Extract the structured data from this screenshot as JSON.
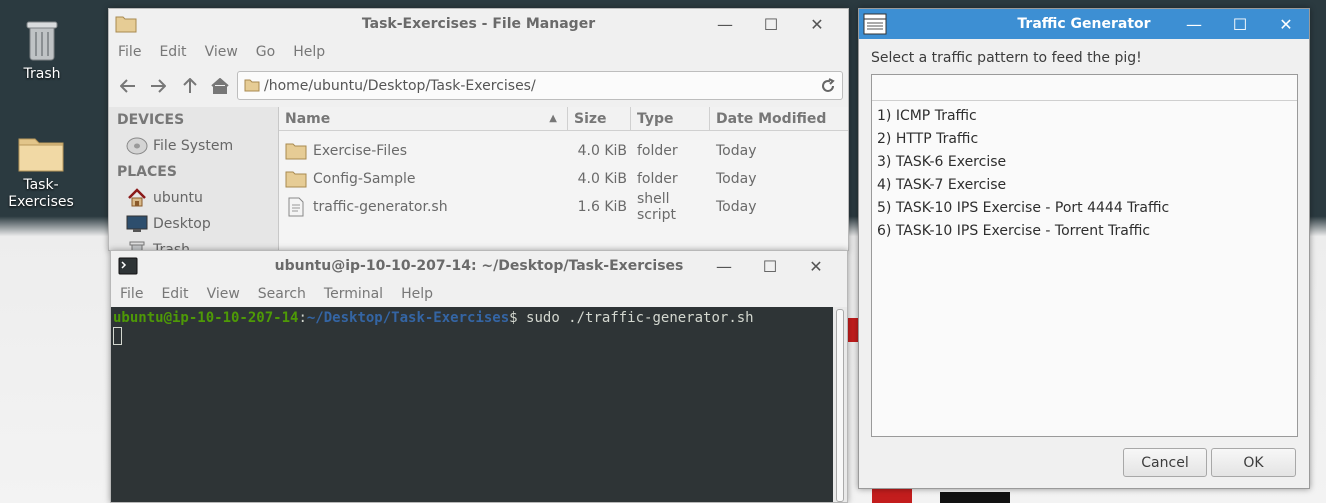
{
  "desktop": {
    "icons": [
      {
        "label": "Trash",
        "icon": "trash-icon"
      },
      {
        "label": "Task-Exercises",
        "icon": "folder-icon"
      }
    ]
  },
  "file_manager": {
    "title": "Task-Exercises - File Manager",
    "menu": [
      "File",
      "Edit",
      "View",
      "Go",
      "Help"
    ],
    "path": "/home/ubuntu/Desktop/Task-Exercises/",
    "sidebar": {
      "devices_header": "DEVICES",
      "devices": [
        {
          "label": "File System",
          "icon": "drive-icon"
        }
      ],
      "places_header": "PLACES",
      "places": [
        {
          "label": "ubuntu",
          "icon": "home-icon"
        },
        {
          "label": "Desktop",
          "icon": "desktop-icon"
        },
        {
          "label": "Trash",
          "icon": "trash-icon"
        }
      ]
    },
    "columns": [
      "Name",
      "Size",
      "Type",
      "Date Modified"
    ],
    "rows": [
      {
        "name": "Exercise-Files",
        "size": "4.0 KiB",
        "type": "folder",
        "date": "Today",
        "icon": "folder-icon"
      },
      {
        "name": "Config-Sample",
        "size": "4.0 KiB",
        "type": "folder",
        "date": "Today",
        "icon": "folder-icon"
      },
      {
        "name": "traffic-generator.sh",
        "size": "1.6 KiB",
        "type": "shell script",
        "date": "Today",
        "icon": "script-icon"
      }
    ]
  },
  "terminal": {
    "title": "ubuntu@ip-10-10-207-14: ~/Desktop/Task-Exercises",
    "menu": [
      "File",
      "Edit",
      "View",
      "Search",
      "Terminal",
      "Help"
    ],
    "prompt_user": "ubuntu@ip-10-10-207-14",
    "prompt_sep": ":",
    "prompt_path": "~/Desktop/Task-Exercises",
    "prompt_symbol": "$",
    "command": " sudo ./traffic-generator.sh"
  },
  "dialog": {
    "title": "Traffic Generator",
    "prompt": "Select a traffic pattern to feed the pig!",
    "entry_value": "",
    "options": [
      "1) ICMP Traffic",
      "2) HTTP Traffic",
      "3) TASK-6 Exercise",
      "4) TASK-7 Exercise",
      "5) TASK-10 IPS Exercise - Port 4444 Traffic",
      "6) TASK-10 IPS Exercise - Torrent Traffic"
    ],
    "cancel_label": "Cancel",
    "ok_label": "OK",
    "accent_color": "#3d8fd3"
  },
  "window_controls": {
    "minimize": "—",
    "maximize": "☐",
    "close": "✕"
  }
}
